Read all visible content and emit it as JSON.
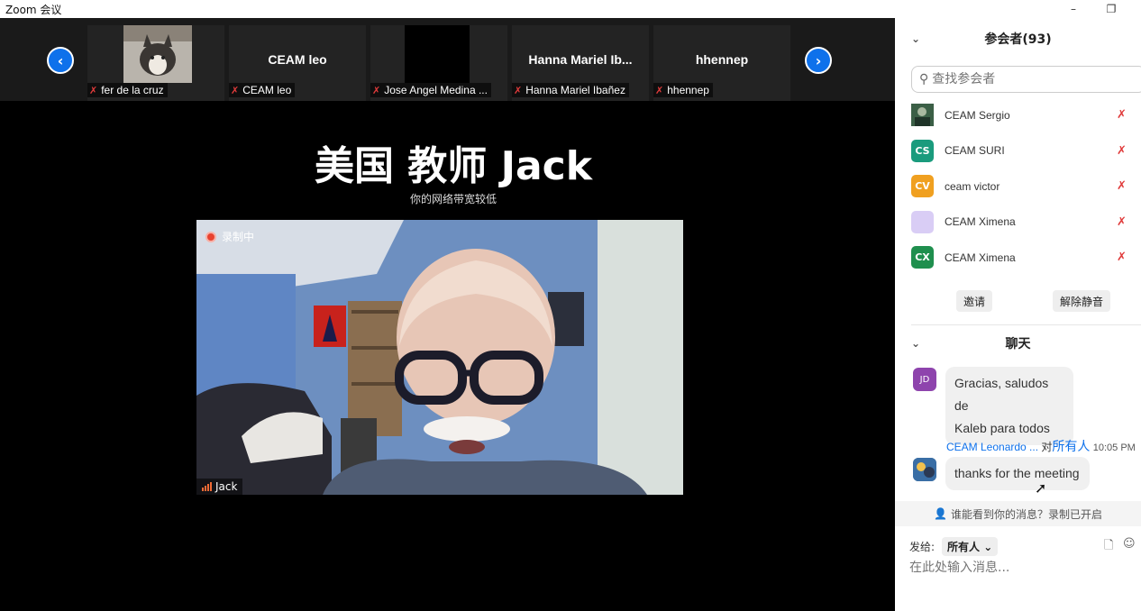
{
  "window": {
    "title": "Zoom 会议",
    "minimize": "–",
    "restore": "❐"
  },
  "strip": {
    "prev": "‹",
    "next": "›",
    "thumbs": [
      {
        "big": "",
        "label": "fer de la cruz"
      },
      {
        "big": "CEAM leo",
        "label": "CEAM leo"
      },
      {
        "big": "",
        "label": "Jose Angel Medina ..."
      },
      {
        "big": "Hanna  Mariel  Ib...",
        "label": "Hanna Mariel Ibañez"
      },
      {
        "big": "hhennep",
        "label": "hhennep"
      }
    ]
  },
  "speaker": {
    "title": "美国 教师 Jack",
    "subtitle": "你的网络带宽较低",
    "recording": "录制中",
    "name": "Jack"
  },
  "participants": {
    "header": "参会者(93)",
    "search_placeholder": "查找参会者",
    "list": [
      {
        "initials": "",
        "name": "CEAM Sergio",
        "color": "#2e6b4a"
      },
      {
        "initials": "CS",
        "name": "CEAM SURI",
        "color": "#1a9b7d"
      },
      {
        "initials": "CV",
        "name": "ceam victor",
        "color": "#f0a020"
      },
      {
        "initials": "",
        "name": "CEAM Ximena",
        "color": "#d9cdf5"
      },
      {
        "initials": "CX",
        "name": "CEAM Ximena",
        "color": "#1f8f4e"
      }
    ],
    "invite": "邀请",
    "unmute": "解除静音"
  },
  "chat": {
    "header": "聊天",
    "messages": [
      {
        "avatar": "JD",
        "avatar_color": "#8e44ad",
        "line1": "Gracias, saludos de",
        "line2": "Kaleb para todos"
      },
      {
        "sender": "CEAM Leonardo ...",
        "to_prefix": " 对",
        "to": "所有人",
        "time": "10:05 PM",
        "text": "thanks for the meeting",
        "avatar_color": "#3a6ea5"
      }
    ],
    "notice": "谁能看到你的消息？录制已开启",
    "send_label": "发给:",
    "send_target": "所有人 ⌄",
    "input_placeholder": "在此处输入消息..."
  },
  "colors": {
    "accent": "#0e71eb",
    "muted": "#e03b3b",
    "recording": "#e8422f"
  }
}
